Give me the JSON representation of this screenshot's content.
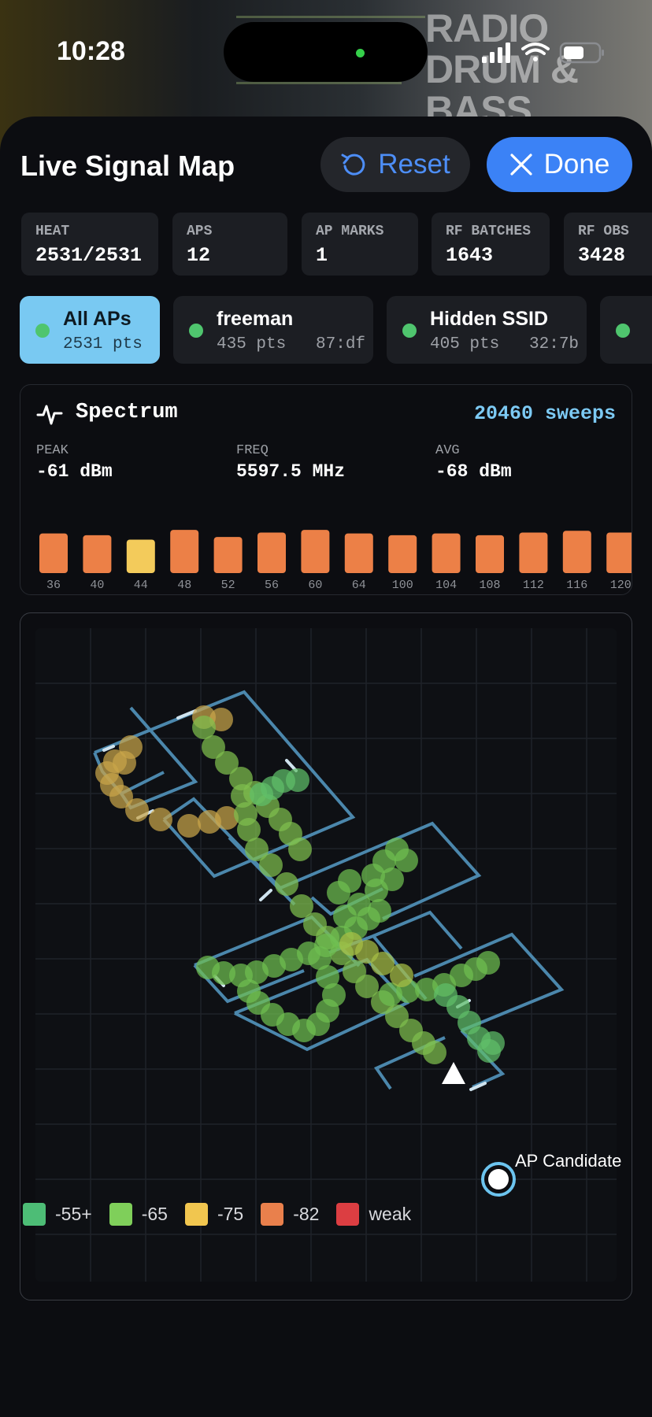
{
  "status_bar": {
    "time": "10:28"
  },
  "background": {
    "logo_lines": [
      "RADIO",
      "DRUM &",
      "BASS"
    ]
  },
  "header": {
    "title": "Live Signal Map",
    "reset_label": "Reset",
    "done_label": "Done"
  },
  "stats": [
    {
      "label": "HEAT",
      "value": "2531/2531"
    },
    {
      "label": "APS",
      "value": "12"
    },
    {
      "label": "AP MARKS",
      "value": "1"
    },
    {
      "label": "RF BATCHES",
      "value": "1643"
    },
    {
      "label": "RF OBS",
      "value": "3428"
    }
  ],
  "ap_filters": [
    {
      "name": "All APs",
      "sub": "2531 pts",
      "active": true
    },
    {
      "name": "freeman",
      "sub": "435 pts   87:df",
      "active": false
    },
    {
      "name": "Hidden SSID",
      "sub": "405 pts   32:7b",
      "active": false
    },
    {
      "name": "",
      "sub": "",
      "active": false
    }
  ],
  "spectrum": {
    "title": "Spectrum",
    "sweeps": "20460 sweeps",
    "peak_label": "PEAK",
    "peak_value": "-61 dBm",
    "freq_label": "FREQ",
    "freq_value": "5597.5 MHz",
    "avg_label": "AVG",
    "avg_value": "-68 dBm"
  },
  "chart_data": {
    "type": "bar",
    "categories": [
      "36",
      "40",
      "44",
      "48",
      "52",
      "56",
      "60",
      "64",
      "100",
      "104",
      "108",
      "112",
      "116",
      "120"
    ],
    "values": [
      0.9,
      0.86,
      0.76,
      0.98,
      0.82,
      0.92,
      0.98,
      0.9,
      0.86,
      0.9,
      0.86,
      0.92,
      0.96,
      0.92
    ],
    "highlight_index": 2,
    "colors": {
      "bar": "#ec8047",
      "highlight": "#f3cb5b"
    }
  },
  "map": {
    "candidate_label": "AP Candidate",
    "colors": {
      "wall": "#4b87ac",
      "grid": "#1f2329",
      "candidate": "#6cc4ef"
    }
  },
  "legend": [
    {
      "label": "-55+",
      "color": "#4dbd76"
    },
    {
      "label": "-65",
      "color": "#7fcf5a"
    },
    {
      "label": "-75",
      "color": "#f1c64f"
    },
    {
      "label": "-82",
      "color": "#e9804c"
    },
    {
      "label": "weak",
      "color": "#dc3e42"
    }
  ]
}
